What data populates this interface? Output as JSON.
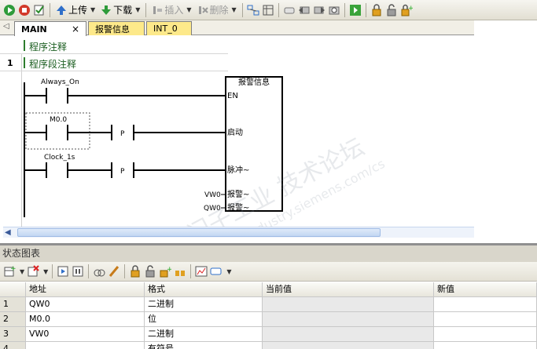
{
  "toolbar": {
    "upload_label": "上传",
    "download_label": "下载",
    "insert_label": "插入",
    "delete_label": "删除"
  },
  "tabs": [
    {
      "label": "MAIN"
    },
    {
      "label": "报警信息"
    },
    {
      "label": "INT_0"
    }
  ],
  "editor": {
    "program_comment": "程序注释",
    "network_number": "1",
    "network_comment": "程序段注释",
    "contacts": [
      {
        "label": "Always_On"
      },
      {
        "label": "M0.0"
      },
      {
        "label": "Clock_1s"
      }
    ],
    "edge_label": "P",
    "block": {
      "title": "报警信息",
      "pins": [
        "EN",
        "启动",
        "脉冲~",
        "报警~",
        "报警~"
      ],
      "pin_operands": [
        "VW0",
        "QW0"
      ]
    }
  },
  "watermark": {
    "line1": "西门子工业  技术论坛",
    "line2": "support.industry.siemens.com/cs"
  },
  "status_chart": {
    "title": "状态图表",
    "columns": [
      "",
      "地址",
      "格式",
      "当前值",
      "新值"
    ],
    "rows": [
      {
        "idx": "1",
        "addr": "QW0",
        "fmt": "二进制",
        "cur": "",
        "new": ""
      },
      {
        "idx": "2",
        "addr": "M0.0",
        "fmt": "位",
        "cur": "",
        "new": ""
      },
      {
        "idx": "3",
        "addr": "VW0",
        "fmt": "二进制",
        "cur": "",
        "new": ""
      },
      {
        "idx": "4",
        "addr": "",
        "fmt": "有符号",
        "cur": "",
        "new": ""
      }
    ]
  },
  "colors": {
    "tab_active": "#ffffff",
    "tab_inactive": "#fde98a",
    "comment_green": "#1b5e20"
  }
}
